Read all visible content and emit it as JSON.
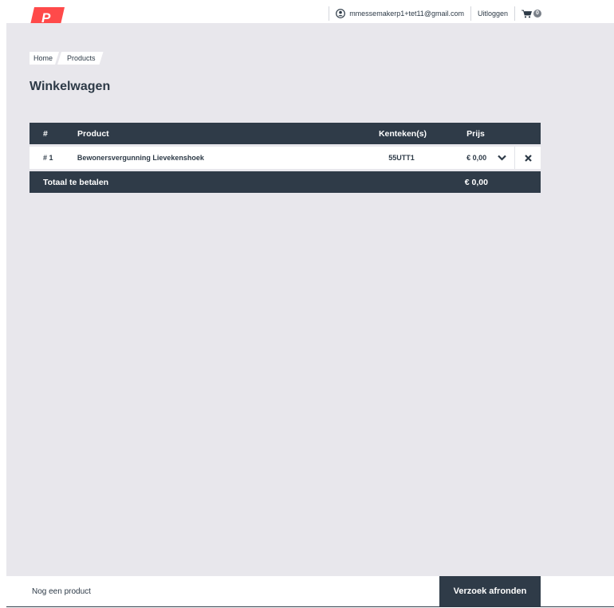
{
  "header": {
    "logo_text": "P",
    "user_email": "mmessemakerp1+tet11@gmail.com",
    "logout_label": "Uitloggen",
    "cart_count": "0"
  },
  "breadcrumb": [
    "Home",
    "Products"
  ],
  "page": {
    "title": "Winkelwagen"
  },
  "table": {
    "columns": [
      "#",
      "Product",
      "Kenteken(s)",
      "Prijs"
    ],
    "rows": [
      {
        "num": "# 1",
        "product": "Bewonersvergunning Lievekenshoek",
        "plate": "55UTT1",
        "price": "€ 0,00"
      }
    ],
    "total_label": "Totaal te betalen",
    "total_value": "€ 0,00"
  },
  "footer": {
    "another_product": "Nog een product",
    "submit_label": "Verzoek afronden"
  },
  "colors": {
    "accent": "#ff4a4a",
    "dark": "#2f3b48",
    "background": "#e8e7ec"
  }
}
